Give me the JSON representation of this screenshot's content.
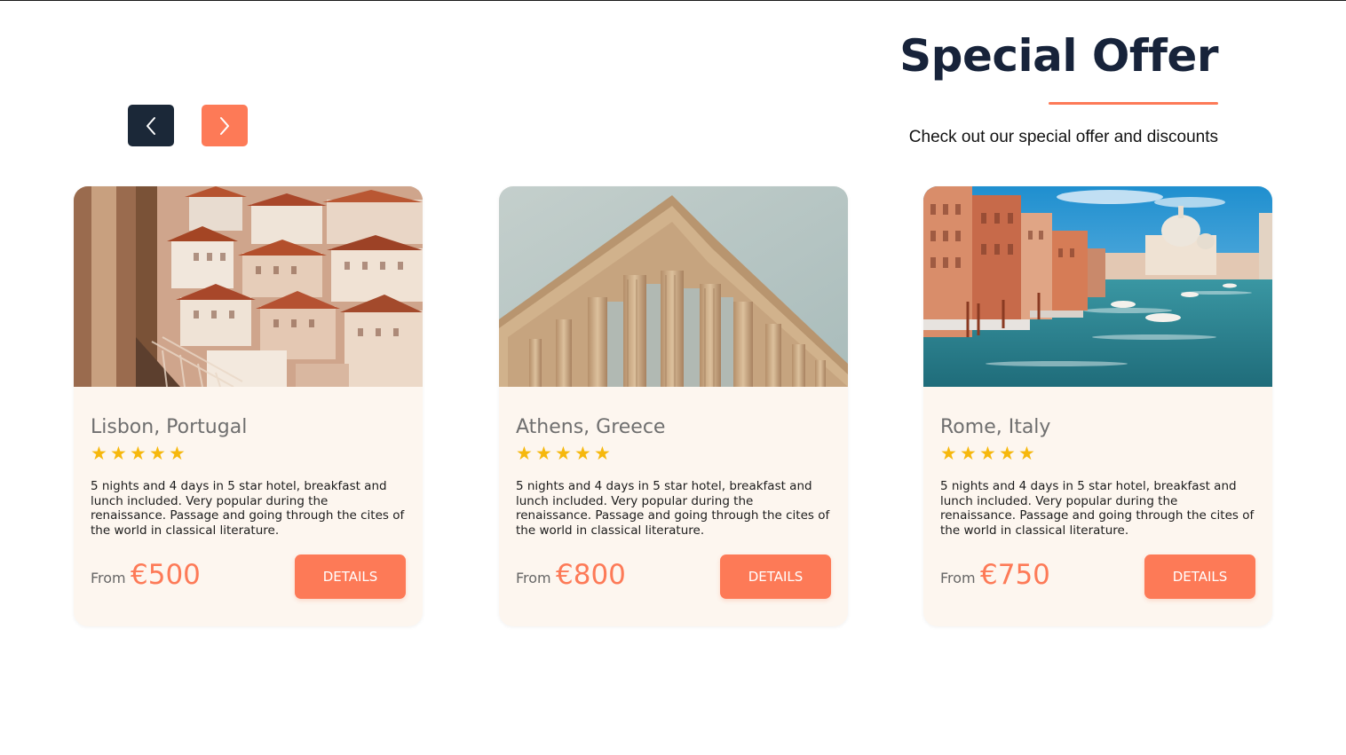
{
  "header": {
    "title": "Special Offer",
    "subtitle": "Check out our special offer and discounts"
  },
  "nav": {
    "prev_icon": "chevron-left-icon",
    "next_icon": "chevron-right-icon"
  },
  "colors": {
    "accent": "#fd7a57",
    "dark": "#1b2838",
    "card_bg": "#fdf6ef",
    "star": "#f6b80d"
  },
  "cards": [
    {
      "name": "Lisbon, Portugal",
      "rating": 5,
      "description": "5 nights and 4 days in 5 star hotel, breakfast and lunch included. Very popular during the renaissance. Passage and going through the cites of the world in classical literature.",
      "from_label": "From",
      "price": "€500",
      "button_label": "DETAILS"
    },
    {
      "name": "Athens, Greece",
      "rating": 5,
      "description": "5 nights and 4 days in 5 star hotel, breakfast and lunch included. Very popular during the renaissance. Passage and going through the cites of the world in classical literature.",
      "from_label": "From",
      "price": "€800",
      "button_label": "DETAILS"
    },
    {
      "name": "Rome, Italy",
      "rating": 5,
      "description": "5 nights and 4 days in 5 star hotel, breakfast and lunch included. Very popular during the renaissance. Passage and going through the cites of the world in classical literature.",
      "from_label": "From",
      "price": "€750",
      "button_label": "DETAILS"
    }
  ]
}
